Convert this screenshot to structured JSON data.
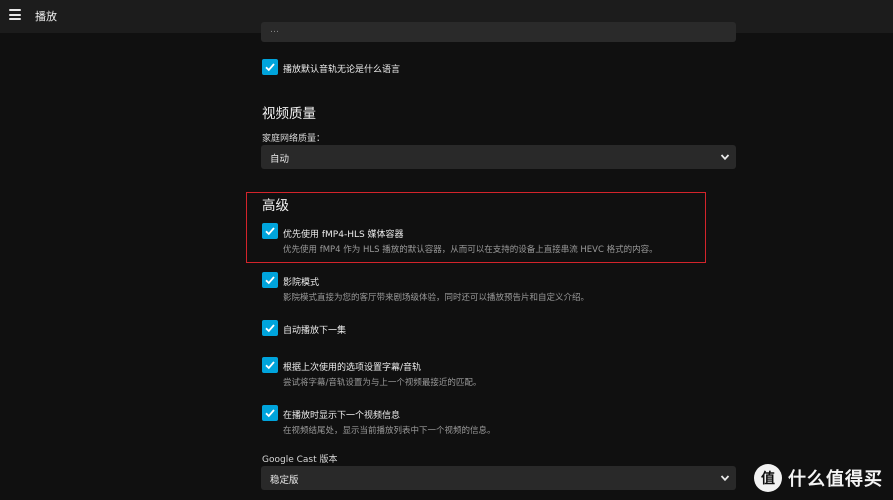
{
  "header": {
    "title": "播放",
    "menu_icon": "hamburger-menu-icon"
  },
  "playback": {
    "partial_field_text": "…",
    "default_audio_label": "播放默认音轨无论是什么语言",
    "default_audio_checked": true
  },
  "video_quality": {
    "heading": "视频质量",
    "home_network_label": "家庭网络质量：",
    "home_network_value": "自动"
  },
  "advanced": {
    "heading": "高级",
    "options": [
      {
        "label": "优先使用 fMP4-HLS 媒体容器",
        "desc": "优先使用 fMP4 作为 HLS 播放的默认容器，从而可以在支持的设备上直接串流 HEVC 格式的内容。",
        "checked": true
      },
      {
        "label": "影院模式",
        "desc": "影院模式直接为您的客厅带来剧场级体验，同时还可以播放预告片和自定义介绍。",
        "checked": true
      },
      {
        "label": "自动播放下一集",
        "desc": "",
        "checked": true
      },
      {
        "label": "根据上次使用的选项设置字幕/音轨",
        "desc": "尝试将字幕/音轨设置为与上一个视频最接近的匹配。",
        "checked": true
      },
      {
        "label": "在播放时显示下一个视频信息",
        "desc": "在视频结尾处，显示当前播放列表中下一个视频的信息。",
        "checked": true
      }
    ]
  },
  "cast": {
    "label": "Google Cast 版本",
    "value": "稳定版"
  },
  "watermark": {
    "text": "什么值得买",
    "logo_glyph": "值"
  },
  "colors": {
    "accent": "#00a4dc",
    "highlight": "#d3242b",
    "background": "#101010",
    "topbar": "#1c1c1c"
  }
}
